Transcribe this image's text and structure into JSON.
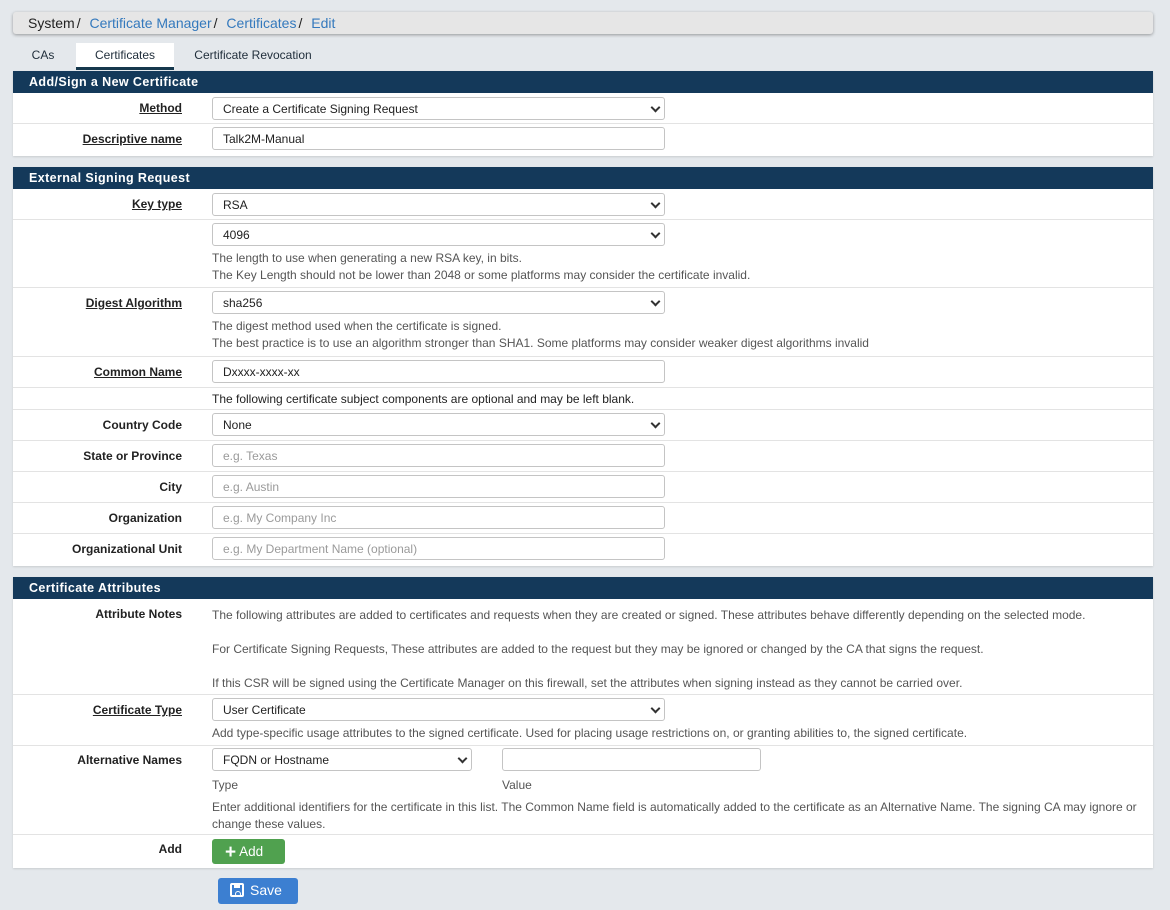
{
  "breadcrumb": {
    "root": "System",
    "sep": "/",
    "item1": "Certificate Manager",
    "item2": "Certificates",
    "item3": "Edit"
  },
  "tabs": {
    "cas": "CAs",
    "certificates": "Certificates",
    "revocation": "Certificate Revocation"
  },
  "add_sign": {
    "heading": "Add/Sign a New Certificate",
    "method_label": "Method",
    "method_value": "Create a Certificate Signing Request",
    "descriptive_name_label": "Descriptive name",
    "descriptive_name_value": "Talk2M-Manual"
  },
  "external": {
    "heading": "External Signing Request",
    "key_type_label": "Key type",
    "key_type_value": "RSA",
    "key_length_value": "4096",
    "key_length_help1": "The length to use when generating a new RSA key, in bits.",
    "key_length_help2": "The Key Length should not be lower than 2048 or some platforms may consider the certificate invalid.",
    "digest_label": "Digest Algorithm",
    "digest_value": "sha256",
    "digest_help1": "The digest method used when the certificate is signed.",
    "digest_help2": "The best practice is to use an algorithm stronger than SHA1. Some platforms may consider weaker digest algorithms invalid",
    "common_name_label": "Common Name",
    "common_name_value": "Dxxxx-xxxx-xx",
    "optional_note": "The following certificate subject components are optional and may be left blank.",
    "country_label": "Country Code",
    "country_value": "None",
    "state_label": "State or Province",
    "state_placeholder": "e.g. Texas",
    "city_label": "City",
    "city_placeholder": "e.g. Austin",
    "org_label": "Organization",
    "org_placeholder": "e.g. My Company Inc",
    "org_unit_label": "Organizational Unit",
    "org_unit_placeholder": "e.g. My Department Name (optional)"
  },
  "attributes": {
    "heading": "Certificate Attributes",
    "notes_label": "Attribute Notes",
    "notes1": "The following attributes are added to certificates and requests when they are created or signed. These attributes behave differently depending on the selected mode.",
    "notes2": "For Certificate Signing Requests, These attributes are added to the request but they may be ignored or changed by the CA that signs the request.",
    "notes3": "If this CSR will be signed using the Certificate Manager on this firewall, set the attributes when signing instead as they cannot be carried over.",
    "cert_type_label": "Certificate Type",
    "cert_type_value": "User Certificate",
    "cert_type_help": "Add type-specific usage attributes to the signed certificate. Used for placing usage restrictions on, or granting abilities to, the signed certificate.",
    "alt_names_label": "Alternative Names",
    "alt_type_value": "FQDN or Hostname",
    "alt_value_value": "",
    "type_caption": "Type",
    "value_caption": "Value",
    "alt_help": "Enter additional identifiers for the certificate in this list. The Common Name field is automatically added to the certificate as an Alternative Name. The signing CA may ignore or change these values.",
    "add_label": "Add",
    "add_button": "Add"
  },
  "save_button": "Save",
  "colors": {
    "panel_heading": "#14395a",
    "link": "#3479bd",
    "add_button": "#50a14f",
    "save_button": "#3c7fd1"
  }
}
